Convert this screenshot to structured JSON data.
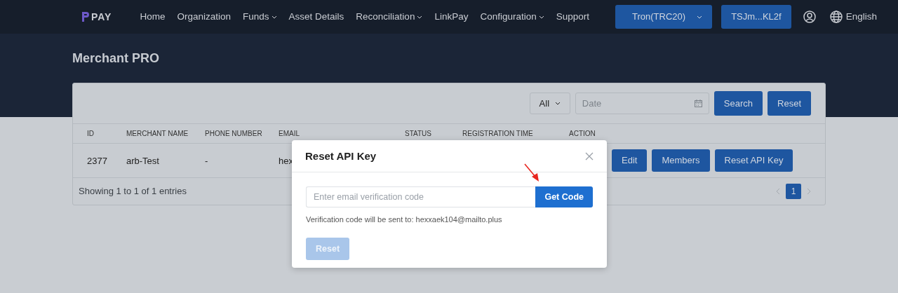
{
  "navbar": {
    "logo": "PAY",
    "items": [
      {
        "label": "Home",
        "dropdown": false
      },
      {
        "label": "Organization",
        "dropdown": false
      },
      {
        "label": "Funds",
        "dropdown": true
      },
      {
        "label": "Asset Details",
        "dropdown": false
      },
      {
        "label": "Reconciliation",
        "dropdown": true
      },
      {
        "label": "LinkPay",
        "dropdown": false
      },
      {
        "label": "Configuration",
        "dropdown": true
      },
      {
        "label": "Support",
        "dropdown": false
      }
    ],
    "network_button": "Tron(TRC20)",
    "wallet_button": "TSJm...KL2f",
    "language": "English"
  },
  "page_title": "Merchant PRO",
  "filters": {
    "status_select": "All",
    "date_placeholder": "Date",
    "buttons": [
      "Search",
      "Reset"
    ]
  },
  "table": {
    "columns": [
      "ID",
      "MERCHANT NAME",
      "PHONE NUMBER",
      "EMAIL",
      "STATUS",
      "REGISTRATION TIME",
      "ACTION"
    ],
    "rows": [
      {
        "cells": [
          "2377",
          "arb-Test",
          "-",
          "hex"
        ],
        "actions": [
          "Edit",
          "Members",
          "Reset API Key"
        ]
      }
    ],
    "footer": "Showing 1 to 1 of 1 entries",
    "pages": [
      {
        "label": "1",
        "selected": true
      }
    ]
  },
  "modal": {
    "title": "Reset API Key",
    "input_placeholder": "Enter email verification code",
    "get_code_button": "Get Code",
    "note": "Verification code will be sent to: hexxaek104@mailto.plus",
    "reset_button": {
      "label": "Reset",
      "disabled": true
    }
  }
}
